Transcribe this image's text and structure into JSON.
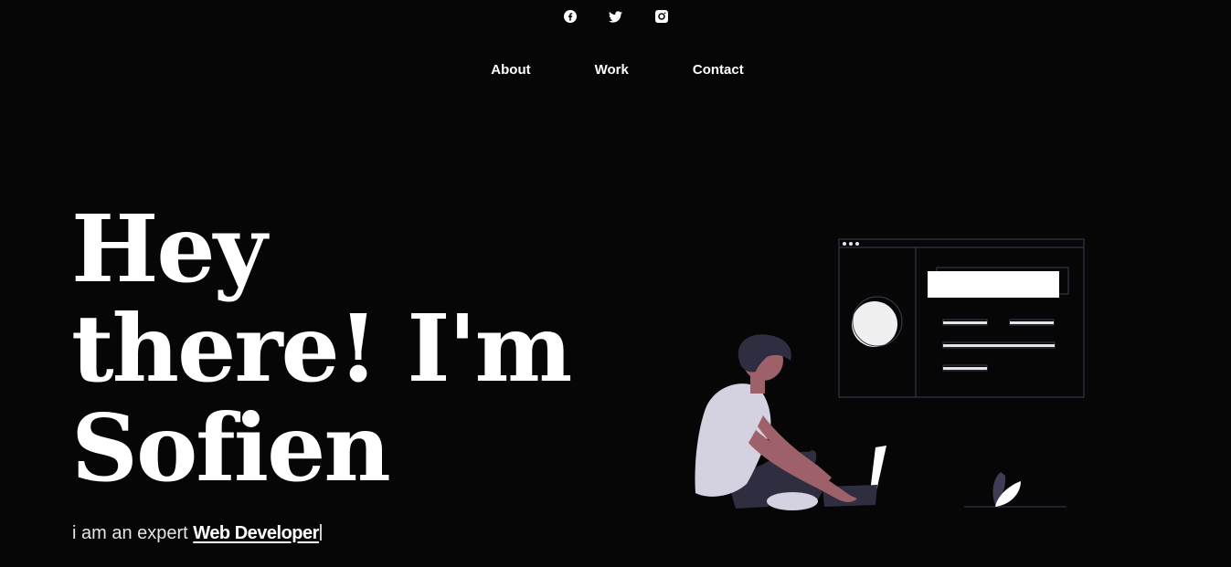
{
  "social": {
    "icons": [
      "facebook-icon",
      "twitter-icon",
      "instagram-icon"
    ]
  },
  "nav": {
    "items": [
      {
        "label": "About"
      },
      {
        "label": "Work"
      },
      {
        "label": "Contact"
      }
    ]
  },
  "hero": {
    "line1": "Hey",
    "line2": "there! I'm",
    "line3": "Sofien",
    "tagline_prefix": "i am an expert ",
    "tagline_role": "Web Developer"
  },
  "colors": {
    "background": "#060606",
    "text": "#ffffff",
    "shirt": "#d4d1e0",
    "skin": "#9e616a",
    "hair": "#2f2e41"
  }
}
